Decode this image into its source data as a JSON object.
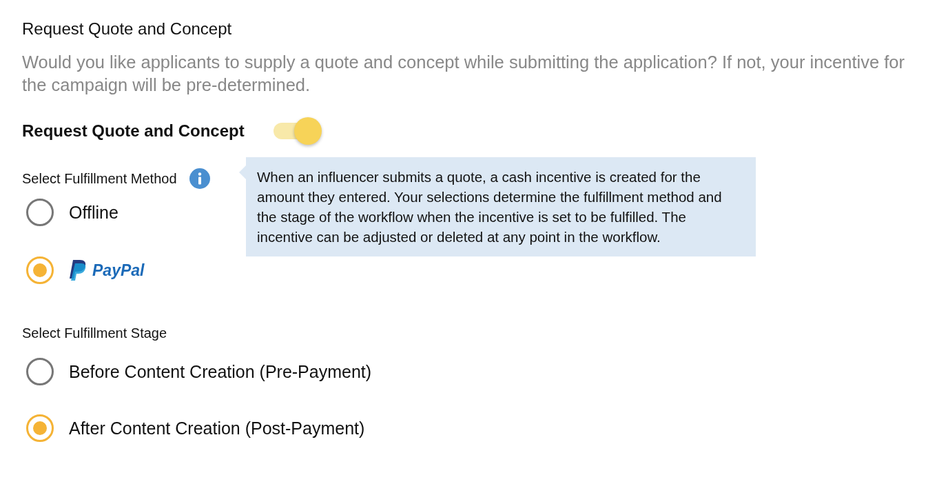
{
  "section": {
    "title": "Request Quote and Concept",
    "description": "Would you like applicants to supply a quote and concept while submitting the application? If not, your incentive for the campaign will be pre-determined."
  },
  "toggle": {
    "label": "Request Quote and Concept",
    "on": true
  },
  "method": {
    "label": "Select Fulfillment Method",
    "tooltip": "When an influencer submits a quote, a cash incentive is created for the amount they entered. Your selections determine the fulfillment method and the stage of the workflow when the incentive is set to be fulfilled. The incentive can be adjusted or deleted at any point in the workflow.",
    "options": [
      {
        "kind": "text",
        "label": "Offline",
        "selected": false
      },
      {
        "kind": "paypal",
        "label": "PayPal",
        "selected": true
      }
    ]
  },
  "stage": {
    "label": "Select Fulfillment Stage",
    "options": [
      {
        "kind": "text",
        "label": "Before Content Creation (Pre-Payment)",
        "selected": false
      },
      {
        "kind": "text",
        "label": "After Content Creation (Post-Payment)",
        "selected": true
      }
    ]
  }
}
